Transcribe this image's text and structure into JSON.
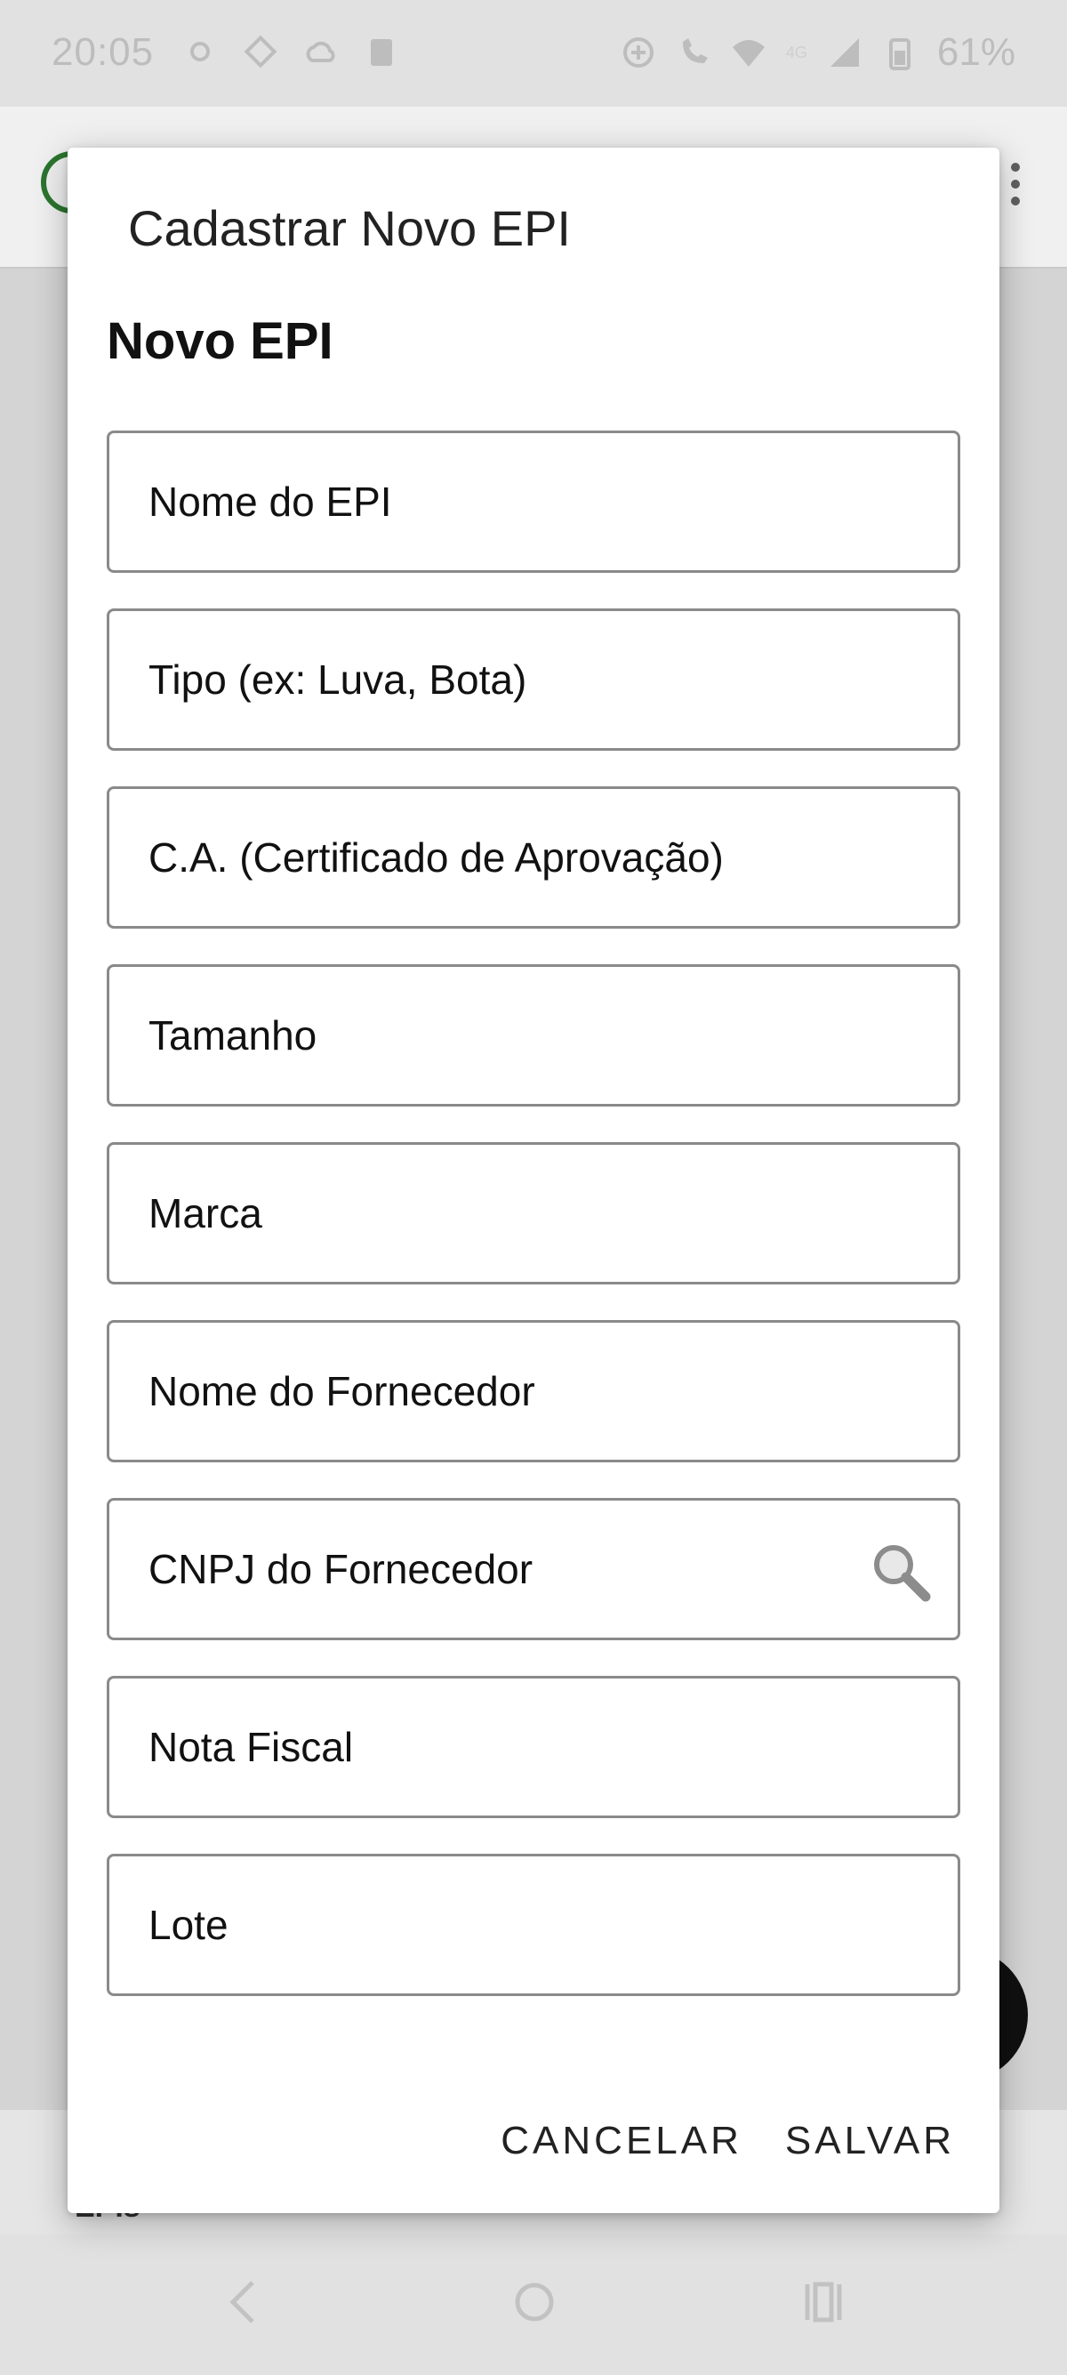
{
  "status_bar": {
    "time": "20:05",
    "battery": "61%",
    "network_label": "4G"
  },
  "background": {
    "bottom_nav_label": "EPIs"
  },
  "dialog": {
    "title": "Cadastrar Novo EPI",
    "heading": "Novo EPI",
    "fields": [
      {
        "placeholder": "Nome do EPI"
      },
      {
        "placeholder": "Tipo (ex: Luva, Bota)"
      },
      {
        "placeholder": "C.A. (Certificado de Aprovação)"
      },
      {
        "placeholder": "Tamanho"
      },
      {
        "placeholder": "Marca"
      },
      {
        "placeholder": "Nome do Fornecedor"
      },
      {
        "placeholder": "CNPJ do Fornecedor"
      },
      {
        "placeholder": "Nota Fiscal"
      },
      {
        "placeholder": "Lote"
      }
    ],
    "cancel_label": "CANCELAR",
    "save_label": "SALVAR"
  },
  "icons": {
    "search": "search-icon"
  },
  "colors": {
    "accent": "#2e7d32",
    "field_border": "#8a8a8a"
  }
}
